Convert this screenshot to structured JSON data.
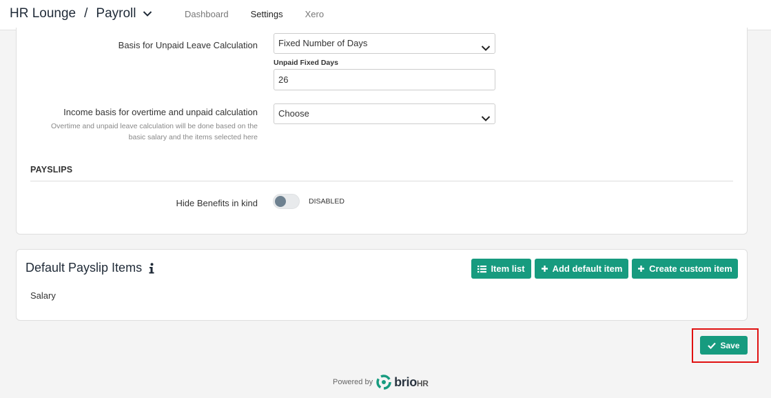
{
  "header": {
    "company": "HR Lounge",
    "separator": "/",
    "module": "Payroll",
    "tabs": [
      {
        "label": "Dashboard",
        "active": false
      },
      {
        "label": "Settings",
        "active": true
      },
      {
        "label": "Xero",
        "active": false
      }
    ]
  },
  "settings": {
    "unpaid_basis": {
      "label": "Basis for Unpaid Leave Calculation",
      "value": "Fixed Number of Days"
    },
    "unpaid_days": {
      "label": "Unpaid Fixed Days",
      "value": "26"
    },
    "income_basis": {
      "label": "Income basis for overtime and unpaid calculation",
      "help_line1": "Overtime and unpaid leave calculation will be done based on the",
      "help_line2": "basic salary and the items selected here",
      "value": "Choose"
    },
    "payslips_section": "PAYSLIPS",
    "hide_benefits": {
      "label": "Hide Benefits in kind",
      "status": "DISABLED",
      "enabled": false
    }
  },
  "default_items": {
    "title": "Default Payslip Items",
    "buttons": {
      "item_list": "Item list",
      "add_default": "Add default item",
      "create_custom": "Create custom item"
    },
    "items": [
      "Salary"
    ]
  },
  "actions": {
    "save": "Save"
  },
  "footer": {
    "powered_by": "Powered by",
    "brand": "brio",
    "brand_suffix": "HR"
  },
  "colors": {
    "accent": "#179b7f",
    "highlight": "#e01010"
  }
}
